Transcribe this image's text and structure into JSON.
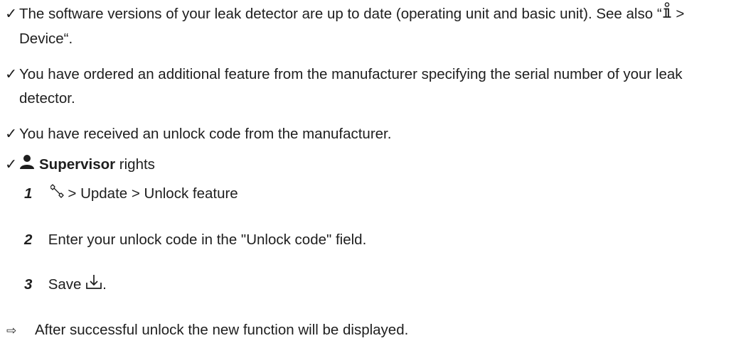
{
  "check_glyph": "✓",
  "result_glyph": "⇨",
  "requirements": {
    "software": {
      "before_icon": "The software versions of your leak detector are up to date (operating unit and basic unit). See also “",
      "icon": "info-icon",
      "after_icon": " > Device“."
    },
    "feature": "You have ordered an additional feature from the manufacturer specifying the serial number of your leak detector.",
    "unlock_code": "You have received an unlock code from the manufacturer.",
    "rights": {
      "icon": "user-icon",
      "bold": "Supervisor",
      "rest": " rights"
    }
  },
  "steps": [
    {
      "number": "1",
      "icon": "wrench-icon",
      "text": " > Update > Unlock feature"
    },
    {
      "number": "2",
      "text": "Enter your unlock code in the \"Unlock code\" field."
    },
    {
      "number": "3",
      "text_before": "Save ",
      "icon": "save-download-icon",
      "text_after": "."
    }
  ],
  "result": "After successful unlock the new function will be displayed."
}
